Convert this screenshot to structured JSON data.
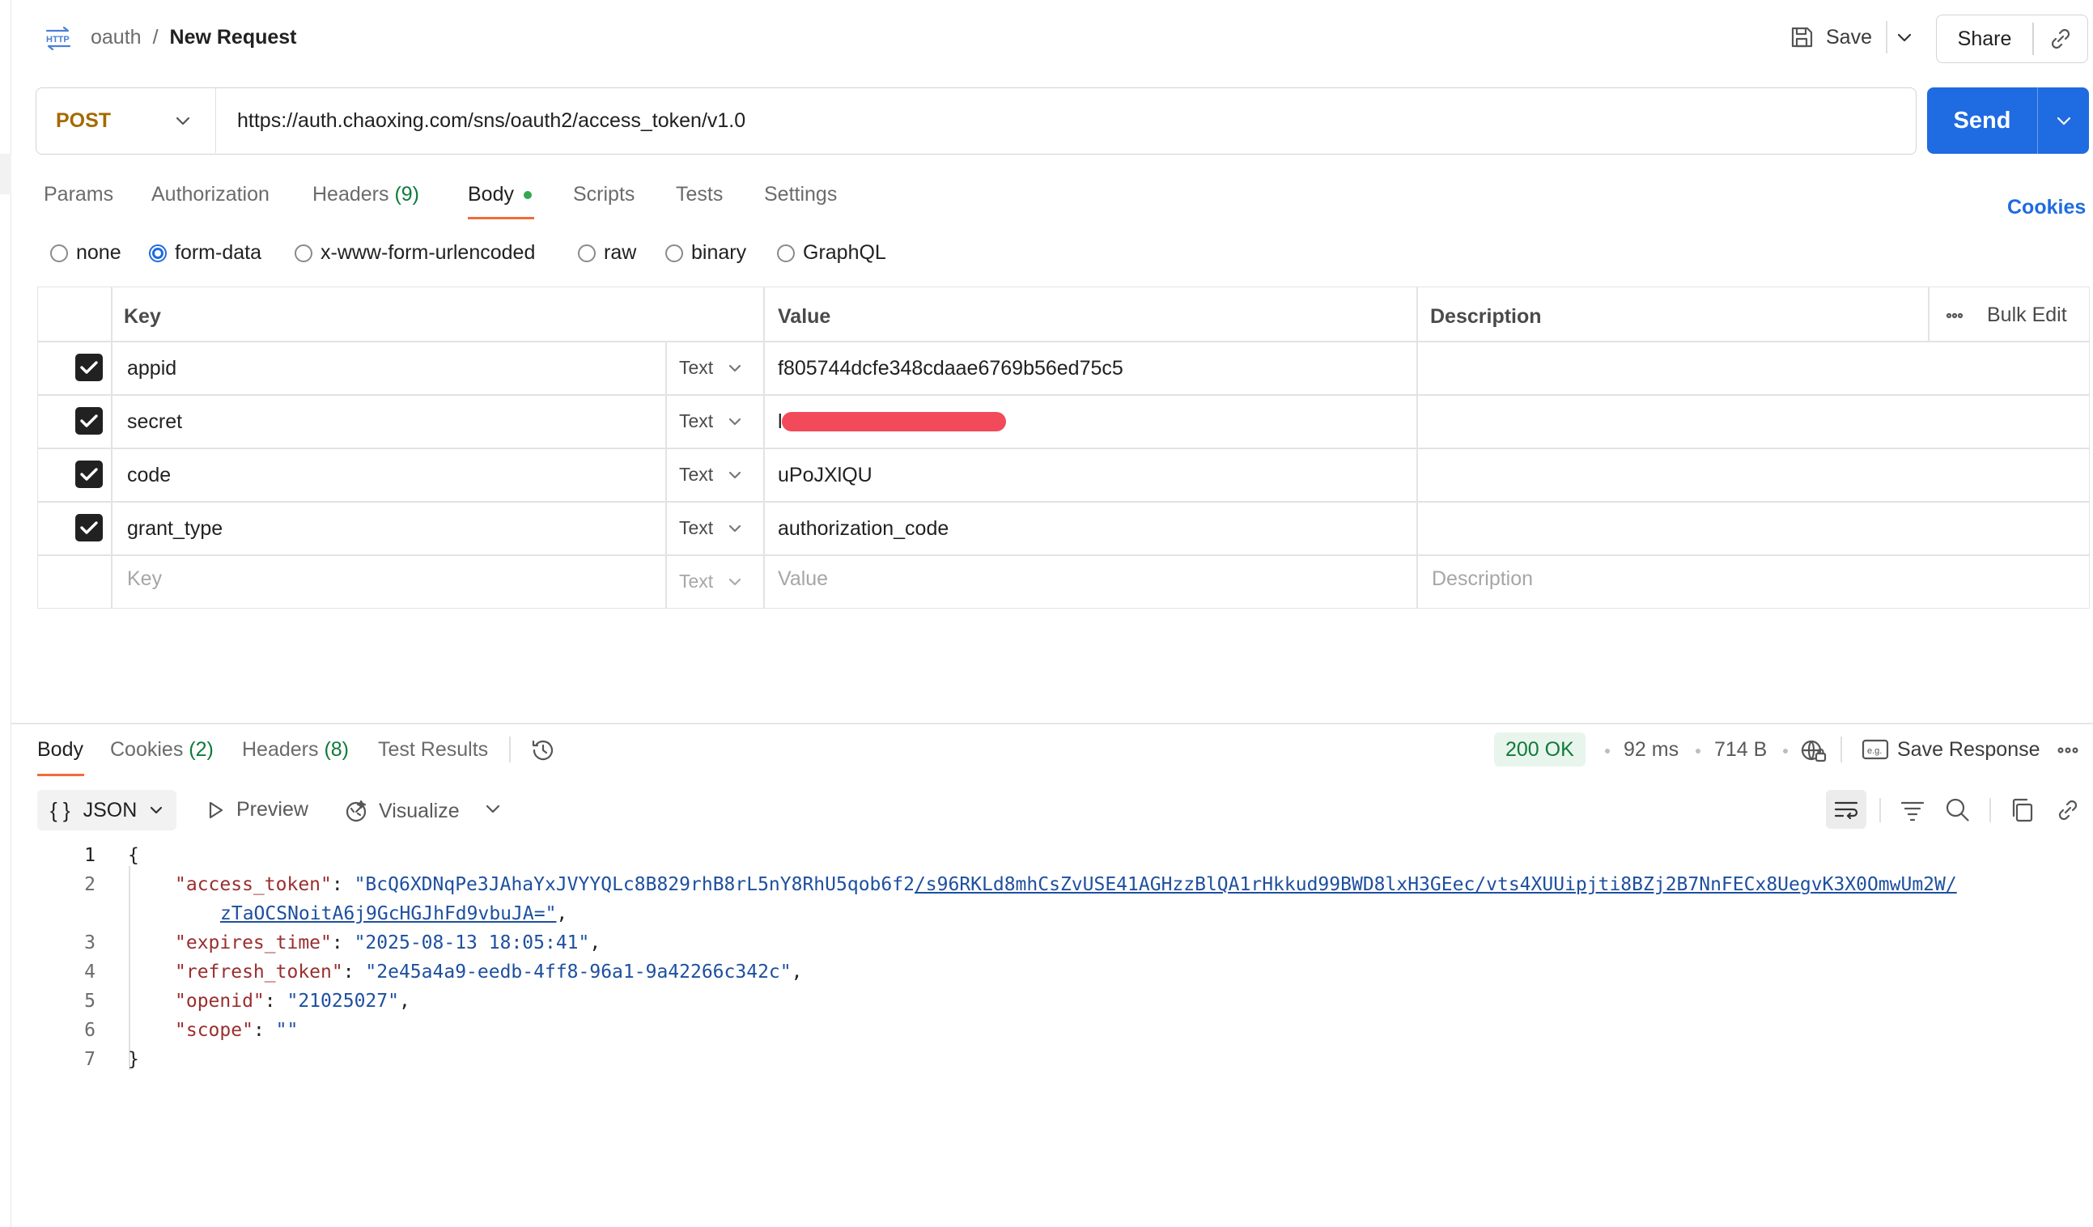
{
  "header": {
    "collection": "oauth",
    "separator": "/",
    "request_name": "New Request",
    "save_label": "Save",
    "share_label": "Share"
  },
  "request": {
    "method": "POST",
    "url": "https://auth.chaoxing.com/sns/oauth2/access_token/v1.0",
    "send_label": "Send"
  },
  "request_tabs": {
    "params": "Params",
    "authorization": "Authorization",
    "headers": "Headers",
    "headers_count": "(9)",
    "body": "Body",
    "scripts": "Scripts",
    "tests": "Tests",
    "settings": "Settings",
    "cookies": "Cookies"
  },
  "body_types": {
    "none": "none",
    "form_data": "form-data",
    "urlencoded": "x-www-form-urlencoded",
    "raw": "raw",
    "binary": "binary",
    "graphql": "GraphQL",
    "selected": "form-data"
  },
  "table": {
    "headers": {
      "key": "Key",
      "value": "Value",
      "description": "Description",
      "bulk_edit": "Bulk Edit"
    },
    "rows": [
      {
        "key": "appid",
        "type": "Text",
        "value": "f805744dcfe348cdaae6769b56ed75c5",
        "checked": true
      },
      {
        "key": "secret",
        "type": "Text",
        "value": "l",
        "checked": true
      },
      {
        "key": "code",
        "type": "Text",
        "value": "uPoJXlQU",
        "checked": true
      },
      {
        "key": "grant_type",
        "type": "Text",
        "value": "authorization_code",
        "checked": true
      }
    ],
    "placeholder": {
      "key": "Key",
      "type": "Text",
      "value": "Value",
      "description": "Description"
    }
  },
  "response_tabs": {
    "body": "Body",
    "cookies": "Cookies",
    "cookies_count": "(2)",
    "headers": "Headers",
    "headers_count": "(8)",
    "test_results": "Test Results"
  },
  "response_meta": {
    "status": "200 OK",
    "time": "92 ms",
    "size": "714 B",
    "save_response": "Save Response"
  },
  "response_toolbar": {
    "format": "JSON",
    "format_glyph": "{ }",
    "preview": "Preview",
    "visualize": "Visualize"
  },
  "response_body": {
    "line_numbers": [
      "1",
      "2",
      "3",
      "4",
      "5",
      "6",
      "7"
    ],
    "open_brace": "{",
    "close_brace": "}",
    "access_token_key": "\"access_token\"",
    "access_token_part1": "\"BcQ6XDNqPe3JAhaYxJVYYQLc8B829rhB8rL5nY8RhU5qob6f2",
    "access_token_part2": "/s96RKLd8mhCsZvUSE41AGHzzBlQA1rHkkud99BWD8lxH3GEec/vts4XUUipjti8BZj2B7NnFECx8UegvK3X0OmwUm2W/",
    "access_token_part3": "zTaOCSNoitA6j9GcHGJhFd9vbuJA=\"",
    "expires_key": "\"expires_time\"",
    "expires_value": "\"2025-08-13 18:05:41\"",
    "refresh_key": "\"refresh_token\"",
    "refresh_value": "\"2e45a4a9-eedb-4ff8-96a1-9a42266c342c\"",
    "openid_key": "\"openid\"",
    "openid_value": "\"21025027\"",
    "scope_key": "\"scope\"",
    "scope_value": "\"\""
  },
  "colors": {
    "accent": "#1f6be1",
    "method": "#a46a00",
    "tab_underline": "#f26b3a",
    "status_ok": "#0f7a3a",
    "redaction": "#f24a5a"
  }
}
